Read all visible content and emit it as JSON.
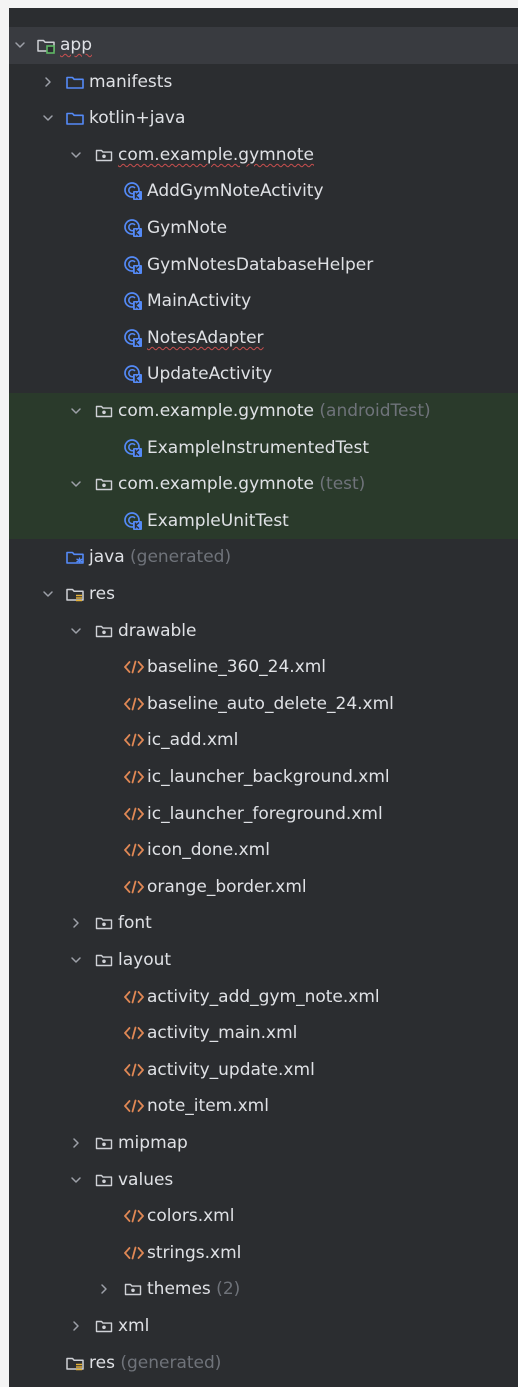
{
  "tree": [
    {
      "depth": 0,
      "state": "expanded",
      "icon": "module-folder-icon",
      "label": "app",
      "selected": true
    },
    {
      "depth": 1,
      "state": "collapsed",
      "icon": "folder-icon",
      "label": "manifests"
    },
    {
      "depth": 1,
      "state": "expanded",
      "icon": "folder-icon",
      "label": "kotlin+java"
    },
    {
      "depth": 2,
      "state": "expanded",
      "icon": "package-icon",
      "label": "com.example.gymnote",
      "error": true
    },
    {
      "depth": 3,
      "state": "none",
      "icon": "kotlin-class-icon",
      "label": "AddGymNoteActivity"
    },
    {
      "depth": 3,
      "state": "none",
      "icon": "kotlin-class-icon",
      "label": "GymNote"
    },
    {
      "depth": 3,
      "state": "none",
      "icon": "kotlin-class-icon",
      "label": "GymNotesDatabaseHelper"
    },
    {
      "depth": 3,
      "state": "none",
      "icon": "kotlin-class-icon",
      "label": "MainActivity"
    },
    {
      "depth": 3,
      "state": "none",
      "icon": "kotlin-class-icon",
      "label": "NotesAdapter",
      "error": true
    },
    {
      "depth": 3,
      "state": "none",
      "icon": "kotlin-class-icon",
      "label": "UpdateActivity"
    },
    {
      "depth": 2,
      "state": "expanded",
      "icon": "package-icon",
      "label": "com.example.gymnote",
      "suffix": "(androidTest)",
      "test": true
    },
    {
      "depth": 3,
      "state": "none",
      "icon": "kotlin-class-icon",
      "label": "ExampleInstrumentedTest",
      "test": true
    },
    {
      "depth": 2,
      "state": "expanded",
      "icon": "package-icon",
      "label": "com.example.gymnote",
      "suffix": "(test)",
      "test": true
    },
    {
      "depth": 3,
      "state": "none",
      "icon": "kotlin-class-icon",
      "label": "ExampleUnitTest",
      "test": true
    },
    {
      "depth": 1,
      "state": "none",
      "icon": "generated-source-folder-icon",
      "label": "java",
      "suffix": "(generated)"
    },
    {
      "depth": 1,
      "state": "expanded",
      "icon": "resource-folder-icon",
      "label": "res"
    },
    {
      "depth": 2,
      "state": "expanded",
      "icon": "package-icon",
      "label": "drawable"
    },
    {
      "depth": 3,
      "state": "none",
      "icon": "xml-file-icon",
      "label": "baseline_360_24.xml"
    },
    {
      "depth": 3,
      "state": "none",
      "icon": "xml-file-icon",
      "label": "baseline_auto_delete_24.xml"
    },
    {
      "depth": 3,
      "state": "none",
      "icon": "xml-file-icon",
      "label": "ic_add.xml"
    },
    {
      "depth": 3,
      "state": "none",
      "icon": "xml-file-icon",
      "label": "ic_launcher_background.xml"
    },
    {
      "depth": 3,
      "state": "none",
      "icon": "xml-file-icon",
      "label": "ic_launcher_foreground.xml"
    },
    {
      "depth": 3,
      "state": "none",
      "icon": "xml-file-icon",
      "label": "icon_done.xml"
    },
    {
      "depth": 3,
      "state": "none",
      "icon": "xml-file-icon",
      "label": "orange_border.xml"
    },
    {
      "depth": 2,
      "state": "collapsed",
      "icon": "package-icon",
      "label": "font"
    },
    {
      "depth": 2,
      "state": "expanded",
      "icon": "package-icon",
      "label": "layout"
    },
    {
      "depth": 3,
      "state": "none",
      "icon": "xml-file-icon",
      "label": "activity_add_gym_note.xml"
    },
    {
      "depth": 3,
      "state": "none",
      "icon": "xml-file-icon",
      "label": "activity_main.xml"
    },
    {
      "depth": 3,
      "state": "none",
      "icon": "xml-file-icon",
      "label": "activity_update.xml"
    },
    {
      "depth": 3,
      "state": "none",
      "icon": "xml-file-icon",
      "label": "note_item.xml"
    },
    {
      "depth": 2,
      "state": "collapsed",
      "icon": "package-icon",
      "label": "mipmap"
    },
    {
      "depth": 2,
      "state": "expanded",
      "icon": "package-icon",
      "label": "values"
    },
    {
      "depth": 3,
      "state": "none",
      "icon": "xml-file-icon",
      "label": "colors.xml"
    },
    {
      "depth": 3,
      "state": "none",
      "icon": "xml-file-icon",
      "label": "strings.xml"
    },
    {
      "depth": 3,
      "state": "collapsed",
      "icon": "package-icon",
      "label": "themes",
      "suffix": "(2)"
    },
    {
      "depth": 2,
      "state": "collapsed",
      "icon": "package-icon",
      "label": "xml"
    },
    {
      "depth": 1,
      "state": "none",
      "icon": "resource-folder-icon",
      "label": "res",
      "suffix": "(generated)"
    }
  ],
  "colors": {
    "panel_bg": "#2b2d30",
    "selected_row": "#393b40",
    "test_row": "#2a3a2b",
    "text": "#dfe1e5",
    "suffix_text": "#6f737a",
    "folder_blue": "#548af7",
    "kotlin_class": "#548af7",
    "xml_orange": "#e08855",
    "module_green": "#5fb865",
    "error_underline": "#c94f4f"
  }
}
